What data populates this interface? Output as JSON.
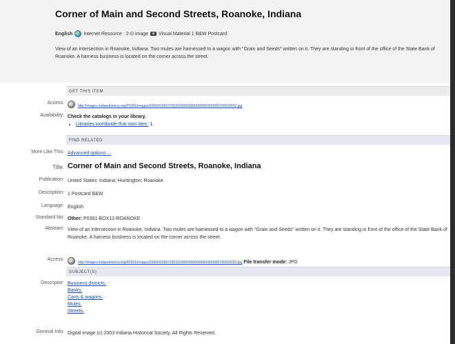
{
  "record": {
    "title": "Corner of Main and Second Streets, Roanoke, Indiana",
    "language": "English",
    "format_internet": "Internet Resource : 2-D image",
    "format_visual": "Visual Material 1 B&W Postcard",
    "summary": "View of an intersection in Roanoke, Indiana. Two mules are harnessed to a wagon with \"Grain and Seeds\" written on it. They are standing in front of the office of the State Bank of Roanoke. A harness business is located on the corner across the street."
  },
  "sections": {
    "get_this_item": "Get This Item",
    "find_related": "Find Related",
    "subjects": "Subject(s)"
  },
  "fields": {
    "access_label": "Access:",
    "access_url": "http://images.indianahistory.org/P0391/images/02660/1000720031600000000000000200000700020032.jpg",
    "availability_label": "Availability:",
    "availability_text": "Check the catalogs in your library.",
    "libraries_link": "Libraries worldwide that own item:",
    "libraries_count": "1",
    "more_like_label": "More Like This:",
    "more_like_link": "Advanced options ...",
    "title_label": "Title:",
    "publication_label": "Publication:",
    "publication": "United States; Indiana; Huntington; Roanoke",
    "description_label": "Description:",
    "description": "1 Postcard B&W",
    "language_label": "Language:",
    "language": "English",
    "standard_label": "Standard No:",
    "standard_prefix": "Other:",
    "standard_value": "P0391-BOX12-ROANOKE",
    "abstract_label": "Abstract:",
    "abstract": "View of an intersection in Roanoke, Indiana. Two mules are harnessed to a wagon with \"Grain and Seeds\" written on it. They are standing in front of the office of the State Bank of Roanoke. A harness business is located on the corner across the street.",
    "access2_label": "Access:",
    "access2_url": "http://images.indianahistory.org/P0391/images/02660/1000720031600000000000000200000700020032.jpg",
    "file_transfer_label": "File transfer mode:",
    "file_transfer_value": "JPG",
    "descriptor_label": "Descriptor:",
    "descriptors": [
      "Business districts.",
      "Banks.",
      "Carts & wagons.",
      "Mules.",
      "Streets."
    ],
    "general_label": "General Info:",
    "general_info": "Digital image (c) 2003 Indiana Historical Society. All Rights Reserved."
  }
}
